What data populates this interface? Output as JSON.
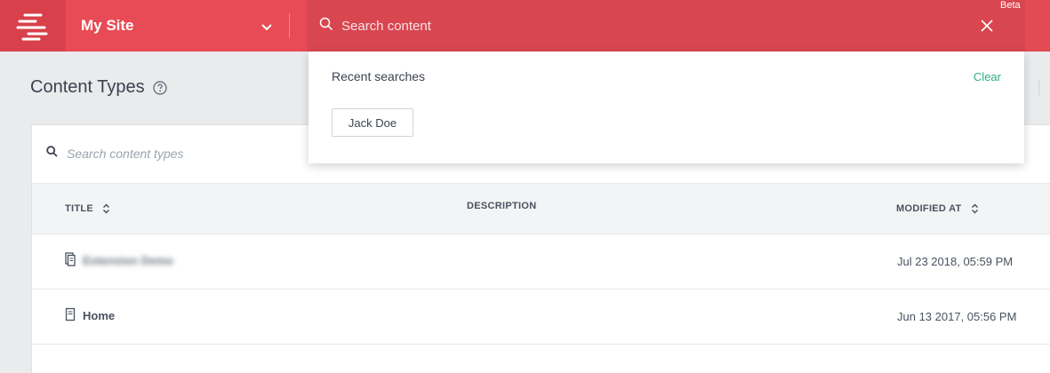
{
  "header": {
    "logo_icon": "stacked-bars-logo-icon",
    "site_name": "My Site",
    "site_chevron_icon": "chevron-down-icon",
    "search_placeholder": "Search content",
    "search_icon": "search-icon",
    "close_icon": "close-icon",
    "beta_label": "Beta",
    "colors": {
      "bar": "#e34a53",
      "search_bg": "#d84650",
      "accent_green": "#2eae7e"
    }
  },
  "page": {
    "title": "Content Types",
    "help_icon": "help-circle-icon"
  },
  "content_search": {
    "placeholder": "Search content types",
    "icon": "search-icon"
  },
  "table": {
    "columns": {
      "title": "TITLE",
      "description": "DESCRIPTION",
      "modified_at": "MODIFIED AT"
    },
    "rows": [
      {
        "title": "Extension Demo",
        "description": "",
        "modified_at": "Jul 23 2018, 05:59 PM",
        "icon": "document-list-icon",
        "title_blurred": true
      },
      {
        "title": "Home",
        "description": "",
        "modified_at": "Jun 13 2017, 05:56 PM",
        "icon": "document-icon",
        "title_blurred": false
      }
    ]
  },
  "search_dropdown": {
    "recent_label": "Recent searches",
    "clear_label": "Clear",
    "recent_items": [
      "Jack Doe"
    ]
  }
}
